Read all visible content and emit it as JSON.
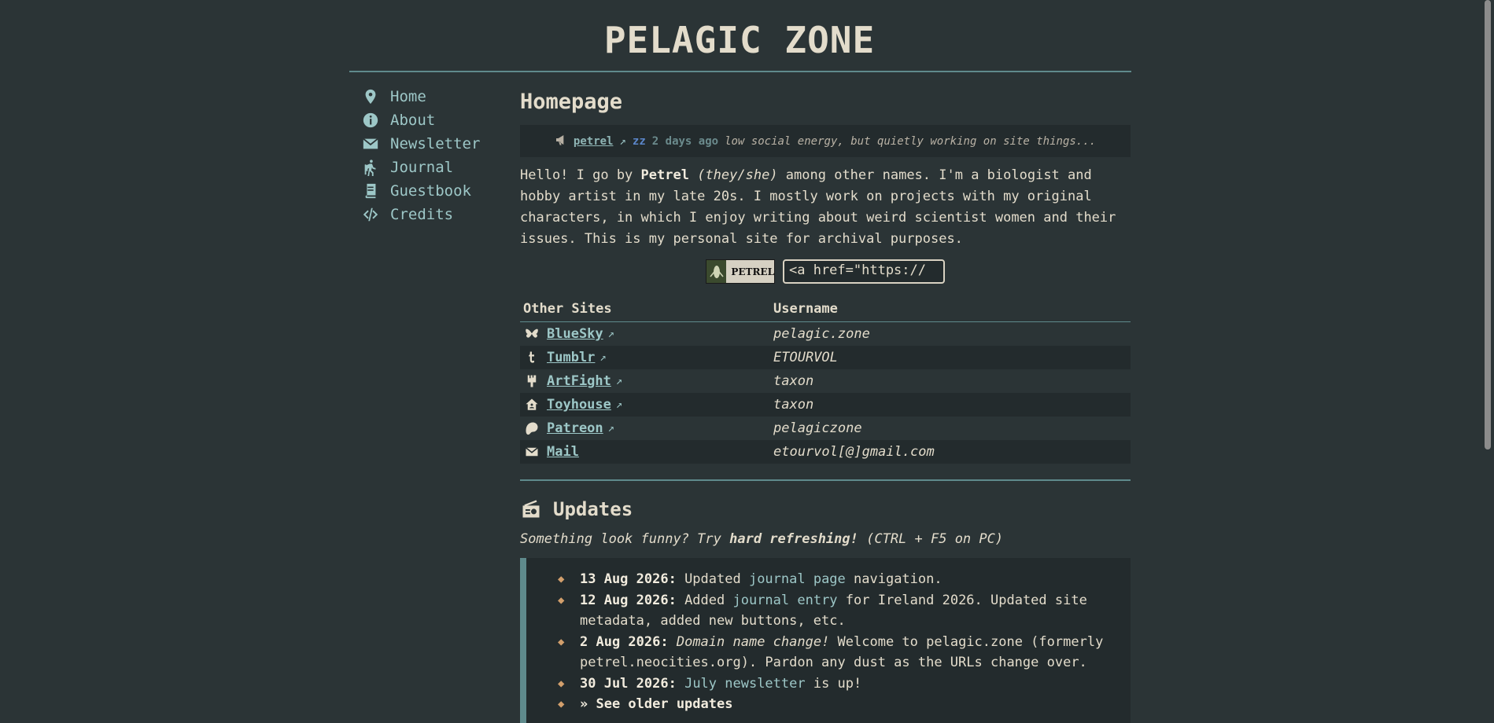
{
  "site": {
    "title": "PELAGIC ZONE"
  },
  "nav": [
    {
      "label": "Home",
      "icon": "map-pin-icon"
    },
    {
      "label": "About",
      "icon": "info-icon"
    },
    {
      "label": "Newsletter",
      "icon": "envelope-icon"
    },
    {
      "label": "Journal",
      "icon": "hiker-icon"
    },
    {
      "label": "Guestbook",
      "icon": "book-icon"
    },
    {
      "label": "Credits",
      "icon": "code-icon"
    }
  ],
  "main": {
    "title": "Homepage",
    "status": {
      "user": "petrel",
      "ext": "↗",
      "time": "2 days ago",
      "message": "low social energy, but quietly working on site things..."
    },
    "intro": {
      "p1": "Hello! I go by ",
      "name": "Petrel",
      "pronouns": "(they/she)",
      "p2": " among other names. I'm a biologist and hobby artist in my late 20s. I mostly work on projects with my original characters, in which I enjoy writing about weird scientist women and their issues. This is my personal site for archival purposes."
    },
    "button": {
      "label": "PETREL",
      "code": "<a href=\"https://"
    },
    "sites_table": {
      "headers": [
        "Other Sites",
        "Username"
      ],
      "rows": [
        {
          "site": "BlueSky",
          "ext": "↗",
          "username": "pelagic.zone",
          "icon": "butterfly-icon"
        },
        {
          "site": "Tumblr",
          "ext": "↗",
          "username": "ETOURVOL",
          "icon": "tumblr-icon"
        },
        {
          "site": "ArtFight",
          "ext": "↗",
          "username": "taxon",
          "icon": "paintbrush-icon"
        },
        {
          "site": "Toyhouse",
          "ext": "↗",
          "username": "taxon",
          "icon": "house-icon"
        },
        {
          "site": "Patreon",
          "ext": "↗",
          "username": "pelagiczone",
          "icon": "patreon-icon"
        },
        {
          "site": "Mail",
          "ext": "",
          "username": "etourvol[@]gmail.com",
          "icon": "envelope-icon"
        }
      ]
    },
    "updates": {
      "title": "Updates",
      "hint_pre": "Something look funny? Try ",
      "hint_bold": "hard refreshing!",
      "hint_post": " (CTRL + F5 on PC)",
      "items": [
        {
          "date": "13 Aug 2026:",
          "t1": " Updated ",
          "link": "journal page",
          "t2": " navigation."
        },
        {
          "date": "12 Aug 2026:",
          "t1": " Added ",
          "link": "journal entry",
          "t2": " for Ireland 2026. Updated site metadata, added new buttons, etc."
        },
        {
          "date": "2 Aug 2026:",
          "t1": " ",
          "em": "Domain name change!",
          "t2": " Welcome to pelagic.zone (formerly petrel.neocities.org). Pardon any dust as the URLs change over."
        },
        {
          "date": "30 Jul 2026:",
          "t1": " ",
          "link": "July newsletter",
          "t2": " is up!"
        }
      ],
      "older": "» See older updates"
    }
  },
  "colors": {
    "bg": "#2b3436",
    "accent": "#9dc7c7",
    "rule": "#5f8a8c",
    "bullet": "#d29f6c"
  }
}
